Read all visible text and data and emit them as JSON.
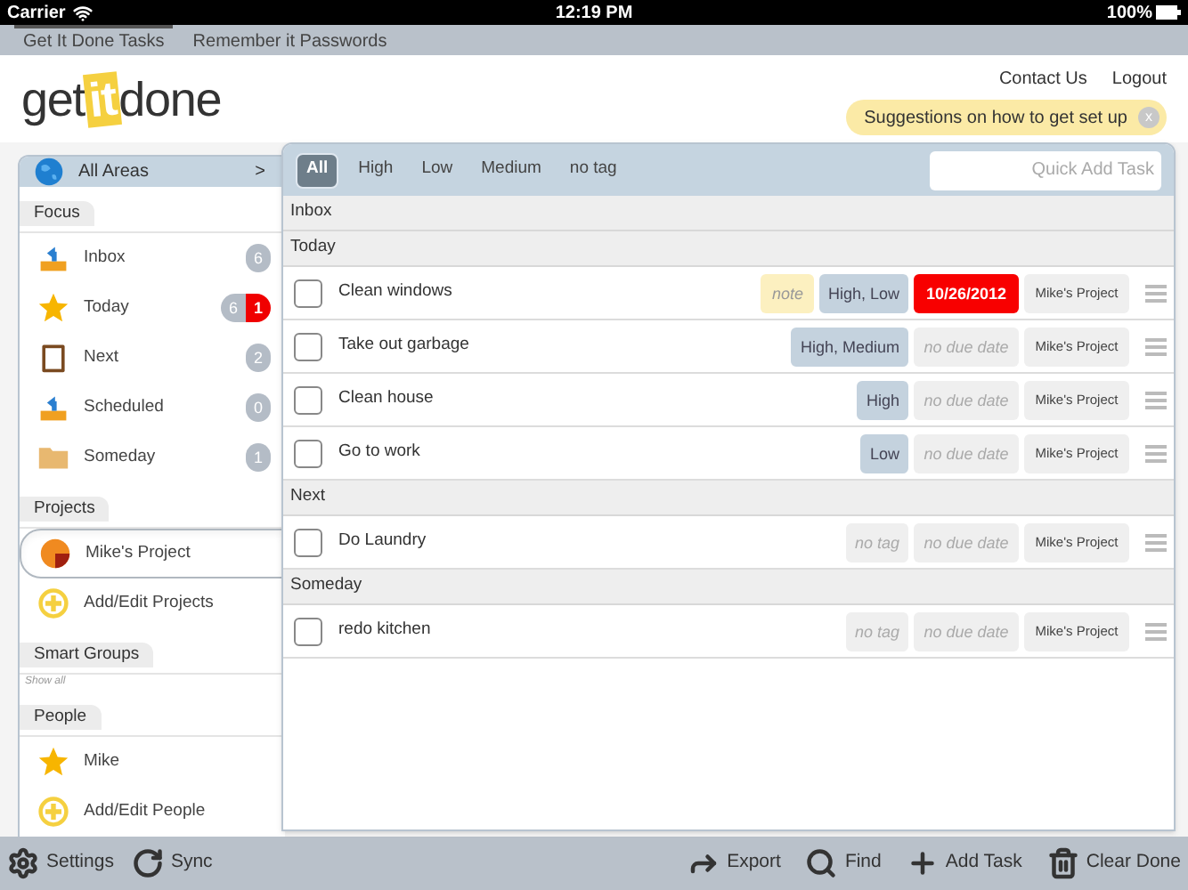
{
  "status_bar": {
    "carrier": "Carrier",
    "time": "12:19 PM",
    "battery": "100%"
  },
  "app_tabs": [
    {
      "label": "Get It Done Tasks",
      "selected": true
    },
    {
      "label": "Remember it Passwords",
      "selected": false
    }
  ],
  "header": {
    "logo": [
      "get",
      "it",
      "done"
    ],
    "links": [
      "Contact Us",
      "Logout"
    ],
    "suggestion": {
      "text": "Suggestions on how to get set up",
      "close": "x"
    }
  },
  "sidebar": {
    "area": {
      "label": "All Areas",
      "arrow": ">"
    },
    "sections": [
      {
        "title": "Focus",
        "items": [
          {
            "kind": "inbox",
            "label": "Inbox",
            "selected": false,
            "badges": [
              {
                "text": "6",
                "overdue": false
              }
            ]
          },
          {
            "kind": "star",
            "label": "Today",
            "selected": false,
            "badges": [
              {
                "text": "6",
                "overdue": false
              },
              {
                "text": "1",
                "overdue": true
              }
            ]
          },
          {
            "kind": "clipboard",
            "label": "Next",
            "selected": false,
            "badges": [
              {
                "text": "2",
                "overdue": false
              }
            ]
          },
          {
            "kind": "inbox",
            "label": "Scheduled",
            "selected": false,
            "badges": [
              {
                "text": "0",
                "overdue": false
              }
            ]
          },
          {
            "kind": "folder",
            "label": "Someday",
            "selected": false,
            "badges": [
              {
                "text": "1",
                "overdue": false
              }
            ]
          }
        ]
      },
      {
        "title": "Projects",
        "items": [
          {
            "kind": "pie",
            "label": "Mike's Project",
            "selected": true
          },
          {
            "kind": "add",
            "label": "Add/Edit Projects",
            "selected": false
          }
        ]
      },
      {
        "title": "Smart Groups",
        "show_all": "Show all"
      },
      {
        "title": "People",
        "items": [
          {
            "kind": "star",
            "label": "Mike",
            "selected": false
          },
          {
            "kind": "add",
            "label": "Add/Edit People",
            "selected": false
          }
        ]
      }
    ]
  },
  "filters": [
    {
      "label": "All",
      "selected": true
    },
    {
      "label": "High",
      "selected": false
    },
    {
      "label": "Low",
      "selected": false
    },
    {
      "label": "Medium",
      "selected": false
    },
    {
      "label": "no tag",
      "selected": false
    }
  ],
  "quick_add": {
    "placeholder": "Quick Add Task"
  },
  "groups": [
    {
      "title": "Inbox"
    },
    {
      "title": "Today",
      "tasks": [
        {
          "title": "Clean windows",
          "checked": false,
          "note": "note",
          "tags": "High, Low",
          "tagged": true,
          "due": "10/26/2012",
          "overdue": true,
          "project": "Mike's Project"
        },
        {
          "title": "Take out garbage",
          "checked": false,
          "tags": "High, Medium",
          "tagged": true,
          "due": "no due date",
          "overdue": false,
          "project": "Mike's Project"
        },
        {
          "title": "Clean house",
          "checked": false,
          "tags": "High",
          "tagged": true,
          "due": "no due date",
          "overdue": false,
          "project": "Mike's Project"
        },
        {
          "title": "Go to work",
          "checked": false,
          "tags": "Low",
          "tagged": true,
          "due": "no due date",
          "overdue": false,
          "project": "Mike's Project"
        }
      ]
    },
    {
      "title": "Next",
      "tasks": [
        {
          "title": "Do Laundry",
          "checked": false,
          "tags": "no tag",
          "tagged": false,
          "due": "no due date",
          "overdue": false,
          "project": "Mike's Project"
        }
      ]
    },
    {
      "title": "Someday",
      "tasks": [
        {
          "title": "redo kitchen",
          "checked": false,
          "tags": "no tag",
          "tagged": false,
          "due": "no due date",
          "overdue": false,
          "project": "Mike's Project"
        }
      ]
    }
  ],
  "toolbar": {
    "left": [
      {
        "kind": "gear",
        "label": "Settings"
      },
      {
        "kind": "sync",
        "label": "Sync"
      }
    ],
    "right": [
      {
        "kind": "export",
        "label": "Export"
      },
      {
        "kind": "search",
        "label": "Find"
      },
      {
        "kind": "plus",
        "label": "Add Task"
      },
      {
        "kind": "trash",
        "label": "Clear Done"
      }
    ]
  }
}
